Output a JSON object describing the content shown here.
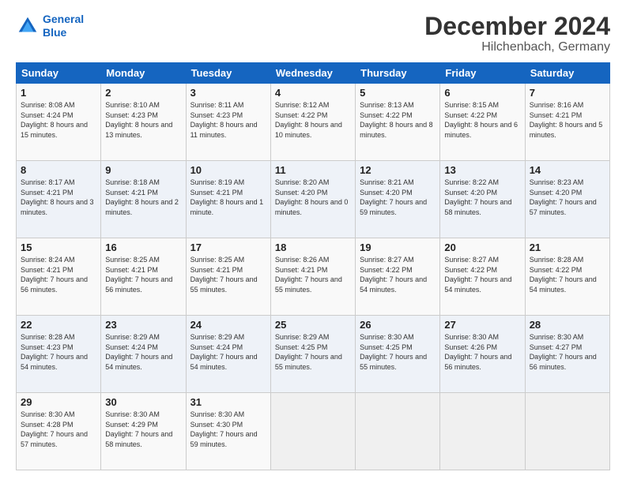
{
  "logo": {
    "line1": "General",
    "line2": "Blue"
  },
  "title": "December 2024",
  "subtitle": "Hilchenbach, Germany",
  "days_header": [
    "Sunday",
    "Monday",
    "Tuesday",
    "Wednesday",
    "Thursday",
    "Friday",
    "Saturday"
  ],
  "weeks": [
    [
      {
        "day": "1",
        "sunrise": "Sunrise: 8:08 AM",
        "sunset": "Sunset: 4:24 PM",
        "daylight": "Daylight: 8 hours and 15 minutes."
      },
      {
        "day": "2",
        "sunrise": "Sunrise: 8:10 AM",
        "sunset": "Sunset: 4:23 PM",
        "daylight": "Daylight: 8 hours and 13 minutes."
      },
      {
        "day": "3",
        "sunrise": "Sunrise: 8:11 AM",
        "sunset": "Sunset: 4:23 PM",
        "daylight": "Daylight: 8 hours and 11 minutes."
      },
      {
        "day": "4",
        "sunrise": "Sunrise: 8:12 AM",
        "sunset": "Sunset: 4:22 PM",
        "daylight": "Daylight: 8 hours and 10 minutes."
      },
      {
        "day": "5",
        "sunrise": "Sunrise: 8:13 AM",
        "sunset": "Sunset: 4:22 PM",
        "daylight": "Daylight: 8 hours and 8 minutes."
      },
      {
        "day": "6",
        "sunrise": "Sunrise: 8:15 AM",
        "sunset": "Sunset: 4:22 PM",
        "daylight": "Daylight: 8 hours and 6 minutes."
      },
      {
        "day": "7",
        "sunrise": "Sunrise: 8:16 AM",
        "sunset": "Sunset: 4:21 PM",
        "daylight": "Daylight: 8 hours and 5 minutes."
      }
    ],
    [
      {
        "day": "8",
        "sunrise": "Sunrise: 8:17 AM",
        "sunset": "Sunset: 4:21 PM",
        "daylight": "Daylight: 8 hours and 3 minutes."
      },
      {
        "day": "9",
        "sunrise": "Sunrise: 8:18 AM",
        "sunset": "Sunset: 4:21 PM",
        "daylight": "Daylight: 8 hours and 2 minutes."
      },
      {
        "day": "10",
        "sunrise": "Sunrise: 8:19 AM",
        "sunset": "Sunset: 4:21 PM",
        "daylight": "Daylight: 8 hours and 1 minute."
      },
      {
        "day": "11",
        "sunrise": "Sunrise: 8:20 AM",
        "sunset": "Sunset: 4:20 PM",
        "daylight": "Daylight: 8 hours and 0 minutes."
      },
      {
        "day": "12",
        "sunrise": "Sunrise: 8:21 AM",
        "sunset": "Sunset: 4:20 PM",
        "daylight": "Daylight: 7 hours and 59 minutes."
      },
      {
        "day": "13",
        "sunrise": "Sunrise: 8:22 AM",
        "sunset": "Sunset: 4:20 PM",
        "daylight": "Daylight: 7 hours and 58 minutes."
      },
      {
        "day": "14",
        "sunrise": "Sunrise: 8:23 AM",
        "sunset": "Sunset: 4:20 PM",
        "daylight": "Daylight: 7 hours and 57 minutes."
      }
    ],
    [
      {
        "day": "15",
        "sunrise": "Sunrise: 8:24 AM",
        "sunset": "Sunset: 4:21 PM",
        "daylight": "Daylight: 7 hours and 56 minutes."
      },
      {
        "day": "16",
        "sunrise": "Sunrise: 8:25 AM",
        "sunset": "Sunset: 4:21 PM",
        "daylight": "Daylight: 7 hours and 56 minutes."
      },
      {
        "day": "17",
        "sunrise": "Sunrise: 8:25 AM",
        "sunset": "Sunset: 4:21 PM",
        "daylight": "Daylight: 7 hours and 55 minutes."
      },
      {
        "day": "18",
        "sunrise": "Sunrise: 8:26 AM",
        "sunset": "Sunset: 4:21 PM",
        "daylight": "Daylight: 7 hours and 55 minutes."
      },
      {
        "day": "19",
        "sunrise": "Sunrise: 8:27 AM",
        "sunset": "Sunset: 4:22 PM",
        "daylight": "Daylight: 7 hours and 54 minutes."
      },
      {
        "day": "20",
        "sunrise": "Sunrise: 8:27 AM",
        "sunset": "Sunset: 4:22 PM",
        "daylight": "Daylight: 7 hours and 54 minutes."
      },
      {
        "day": "21",
        "sunrise": "Sunrise: 8:28 AM",
        "sunset": "Sunset: 4:22 PM",
        "daylight": "Daylight: 7 hours and 54 minutes."
      }
    ],
    [
      {
        "day": "22",
        "sunrise": "Sunrise: 8:28 AM",
        "sunset": "Sunset: 4:23 PM",
        "daylight": "Daylight: 7 hours and 54 minutes."
      },
      {
        "day": "23",
        "sunrise": "Sunrise: 8:29 AM",
        "sunset": "Sunset: 4:24 PM",
        "daylight": "Daylight: 7 hours and 54 minutes."
      },
      {
        "day": "24",
        "sunrise": "Sunrise: 8:29 AM",
        "sunset": "Sunset: 4:24 PM",
        "daylight": "Daylight: 7 hours and 54 minutes."
      },
      {
        "day": "25",
        "sunrise": "Sunrise: 8:29 AM",
        "sunset": "Sunset: 4:25 PM",
        "daylight": "Daylight: 7 hours and 55 minutes."
      },
      {
        "day": "26",
        "sunrise": "Sunrise: 8:30 AM",
        "sunset": "Sunset: 4:25 PM",
        "daylight": "Daylight: 7 hours and 55 minutes."
      },
      {
        "day": "27",
        "sunrise": "Sunrise: 8:30 AM",
        "sunset": "Sunset: 4:26 PM",
        "daylight": "Daylight: 7 hours and 56 minutes."
      },
      {
        "day": "28",
        "sunrise": "Sunrise: 8:30 AM",
        "sunset": "Sunset: 4:27 PM",
        "daylight": "Daylight: 7 hours and 56 minutes."
      }
    ],
    [
      {
        "day": "29",
        "sunrise": "Sunrise: 8:30 AM",
        "sunset": "Sunset: 4:28 PM",
        "daylight": "Daylight: 7 hours and 57 minutes."
      },
      {
        "day": "30",
        "sunrise": "Sunrise: 8:30 AM",
        "sunset": "Sunset: 4:29 PM",
        "daylight": "Daylight: 7 hours and 58 minutes."
      },
      {
        "day": "31",
        "sunrise": "Sunrise: 8:30 AM",
        "sunset": "Sunset: 4:30 PM",
        "daylight": "Daylight: 7 hours and 59 minutes."
      },
      null,
      null,
      null,
      null
    ]
  ]
}
